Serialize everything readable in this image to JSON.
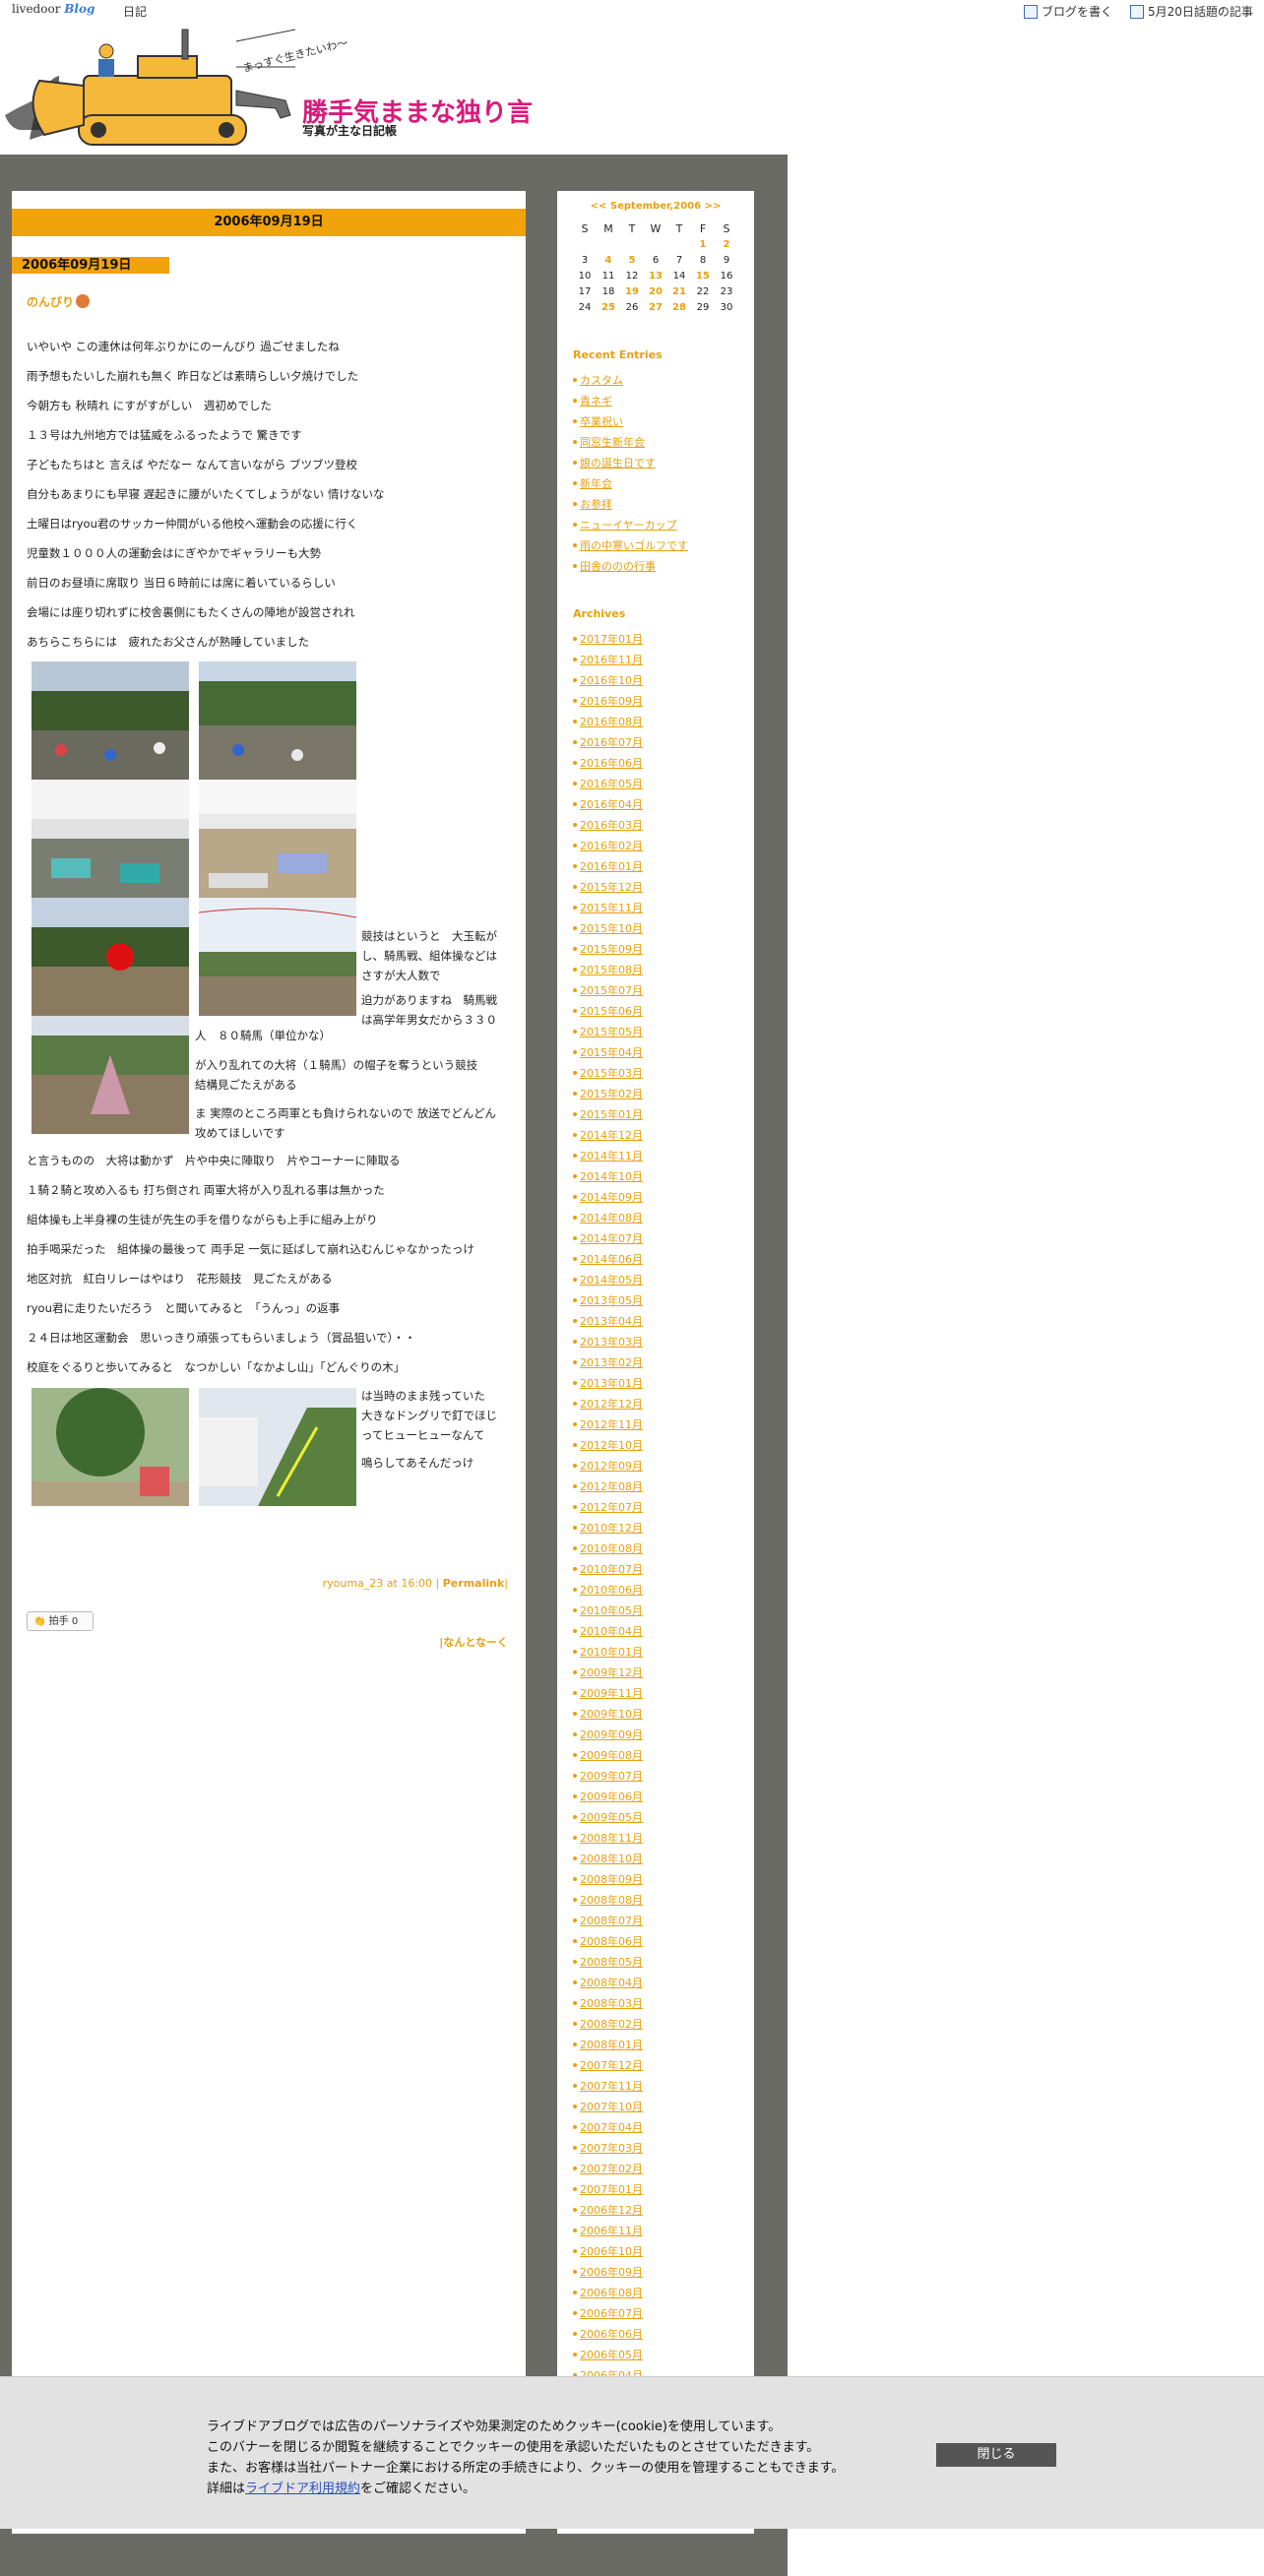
{
  "topbar": {
    "logo_main": "livedoor",
    "logo_sub": "Blog",
    "diary": "日記",
    "write_blog": "ブログを書く",
    "trending": "5月20日話題の記事"
  },
  "header": {
    "title": "勝手気ままな独り言",
    "subtitle": "写真が主な日記帳",
    "motto": "まっすぐ生きたいわ〜"
  },
  "entry": {
    "date_bar": "2006年09月19日",
    "date_tab": "2006年09月19日",
    "title": "のんびり",
    "paragraphs": [
      "いやいや この連休は何年ぶりかにのーんびり 過ごせましたね",
      "雨予想もたいした崩れも無く 昨日などは素晴らしい夕焼けでした",
      "今朝方も 秋晴れ にすがすがしい　週初めでした",
      "１３号は九州地方では猛威をふるったようで 驚きです",
      "子どもたちはと 言えば やだなー なんて言いながら ブツブツ登校",
      "自分もあまりにも早寝 遅起きに腰がいたくてしょうがない 情けないな",
      "土曜日はryou君のサッカー仲間がいる他校へ運動会の応援に行く",
      "児童数１０００人の運動会はにぎやかでギャラリーも大勢",
      "前日のお昼頃に席取り 当日６時前には席に着いているらしい",
      "会場には座り切れずに校舎裏側にもたくさんの陣地が設営されれ",
      "あちらこちらには　疲れたお父さんが熟睡していました"
    ],
    "side_text_1": [
      "競技はというと　大玉転が",
      "し、騎馬戦、組体操などは",
      "さすが大人数で"
    ],
    "side_text_2": [
      "迫力がありますね　騎馬戦",
      "は高学年男女だから３３０"
    ],
    "side_text_3": "人　８０騎馬（単位かな）",
    "side_text_4": [
      "が入り乱れての大将（１騎馬）の帽子を奪うという競技",
      "結構見ごたえがある"
    ],
    "side_text_5": [
      "ま 実際のところ両軍とも負けられないので 放送でどんどん",
      "攻めてほしいです"
    ],
    "paragraphs_2": [
      "と言うものの　大将は動かず　片や中央に陣取り　片やコーナーに陣取る",
      "１騎２騎と攻め入るも 打ち倒され 両軍大将が入り乱れる事は無かった",
      "組体操も上半身裸の生徒が先生の手を借りながらも上手に組み上がり",
      "拍手喝采だった　組体操の最後って 両手足 一気に延ばして崩れ込むんじゃなかったっけ",
      "地区対抗　紅白リレーはやはり　花形競技　見ごたえがある",
      "ryou君に走りたいだろう　と聞いてみると　「うんっ」の返事",
      "２４日は地区運動会　思いっきり頑張ってもらいましょう（賞品狙いで）・・",
      "校庭をぐるりと歩いてみると　なつかしい「なかよし山」「どんぐりの木」"
    ],
    "side_text_6": [
      "は当時のまま残っていた",
      "大きなドングリで釘でほじ",
      "ってヒューヒューなんて"
    ],
    "side_text_7": "鳴らしてあそんだっけ",
    "author": "ryouma_23",
    "time": "at 16:00",
    "permalink": "Permalink",
    "clap_label": "拍手",
    "clap_count": "0",
    "next_link": "なんとなーく"
  },
  "calendar": {
    "prev": "<<",
    "month": "September,2006",
    "next": ">>",
    "weekdays": [
      "S",
      "M",
      "T",
      "W",
      "T",
      "F",
      "S"
    ],
    "weeks": [
      [
        "",
        "",
        "",
        "",
        "",
        "1",
        "2"
      ],
      [
        "3",
        "4",
        "5",
        "6",
        "7",
        "8",
        "9"
      ],
      [
        "10",
        "11",
        "12",
        "13",
        "14",
        "15",
        "16"
      ],
      [
        "17",
        "18",
        "19",
        "20",
        "21",
        "22",
        "23"
      ],
      [
        "24",
        "25",
        "26",
        "27",
        "28",
        "29",
        "30"
      ]
    ],
    "linked_days": [
      "1",
      "2",
      "4",
      "5",
      "13",
      "15",
      "19",
      "20",
      "21",
      "25",
      "27",
      "28"
    ]
  },
  "recent": {
    "title": "Recent Entries",
    "items": [
      "カスタム",
      "青ネギ",
      "卒業祝い",
      "同窓生新年会",
      "娘の誕生日です",
      "新年会",
      "お参拝",
      "ニューイヤーカップ",
      "雨の中寒いゴルフです",
      "田舎ののの行事"
    ]
  },
  "archives": {
    "title": "Archives",
    "items": [
      "2017年01月",
      "2016年11月",
      "2016年10月",
      "2016年09月",
      "2016年08月",
      "2016年07月",
      "2016年06月",
      "2016年05月",
      "2016年04月",
      "2016年03月",
      "2016年02月",
      "2016年01月",
      "2015年12月",
      "2015年11月",
      "2015年10月",
      "2015年09月",
      "2015年08月",
      "2015年07月",
      "2015年06月",
      "2015年05月",
      "2015年04月",
      "2015年03月",
      "2015年02月",
      "2015年01月",
      "2014年12月",
      "2014年11月",
      "2014年10月",
      "2014年09月",
      "2014年08月",
      "2014年07月",
      "2014年06月",
      "2014年05月",
      "2013年05月",
      "2013年04月",
      "2013年03月",
      "2013年02月",
      "2013年01月",
      "2012年12月",
      "2012年11月",
      "2012年10月",
      "2012年09月",
      "2012年08月",
      "2012年07月",
      "2010年12月",
      "2010年08月",
      "2010年07月",
      "2010年06月",
      "2010年05月",
      "2010年04月",
      "2010年01月",
      "2009年12月",
      "2009年11月",
      "2009年10月",
      "2009年09月",
      "2009年08月",
      "2009年07月",
      "2009年06月",
      "2009年05月",
      "2008年11月",
      "2008年10月",
      "2008年09月",
      "2008年08月",
      "2008年07月",
      "2008年06月",
      "2008年05月",
      "2008年04月",
      "2008年03月",
      "2008年02月",
      "2008年01月",
      "2007年12月",
      "2007年11月",
      "2007年10月",
      "2007年04月",
      "2007年03月",
      "2007年02月",
      "2007年01月",
      "2006年12月",
      "2006年11月",
      "2006年10月",
      "2006年09月",
      "2006年08月",
      "2006年07月",
      "2006年06月",
      "2006年05月",
      "2006年04月"
    ]
  },
  "cookie": {
    "line1": "ライブドアブログでは広告のパーソナライズや効果測定のためクッキー(cookie)を使用しています。",
    "line2": "このバナーを閉じるか閲覧を継続することでクッキーの使用を承認いただいたものとさせていただきます。",
    "line3": "また、お客様は当社パートナー企業における所定の手続きにより、クッキーの使用を管理することもできます。",
    "line4_pre": "詳細は",
    "line4_link": "ライブドア利用規約",
    "line4_post": "をご確認ください。",
    "close": "閉じる"
  },
  "colors": {
    "accent": "#f0a30a",
    "link": "#e8a010",
    "title": "#d81b7a",
    "frame": "#6b6b66"
  }
}
